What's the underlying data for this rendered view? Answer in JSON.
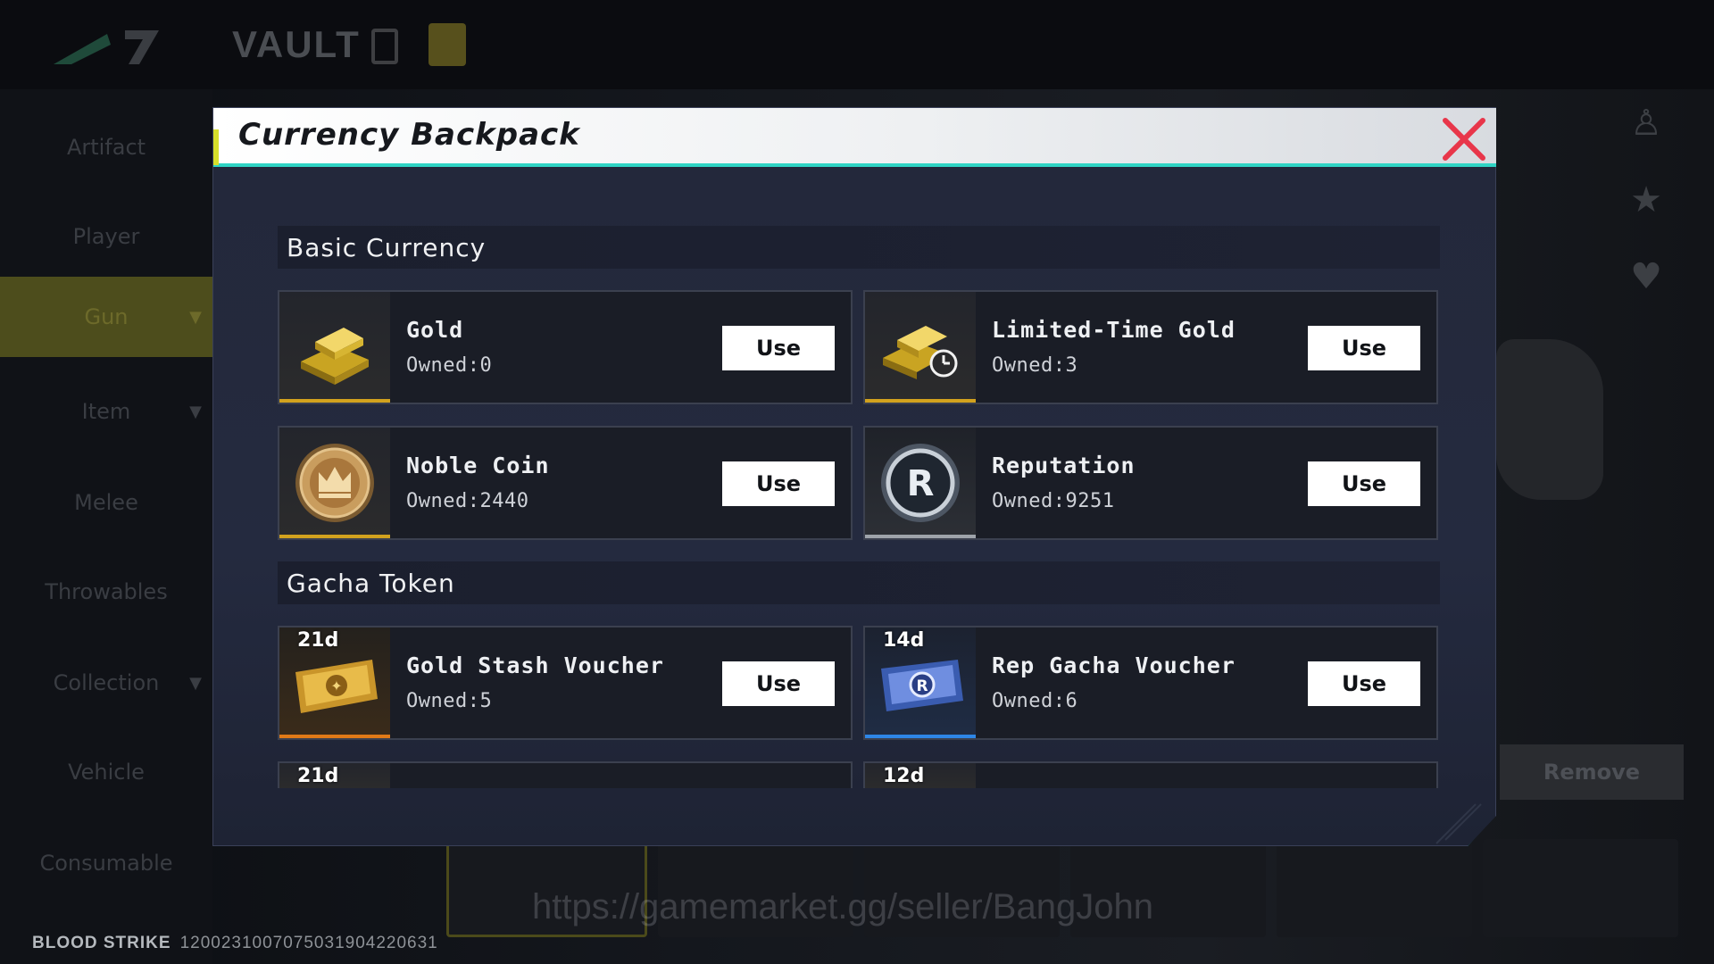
{
  "background": {
    "screen_title": "VAULT",
    "sidebar_items": [
      "Artifact",
      "Player",
      "Gun",
      "Item",
      "Melee",
      "Throwables",
      "Collection",
      "Vehicle",
      "Consumable"
    ],
    "remove_label": "Remove",
    "game_name": "BLOOD STRIKE",
    "player_id": "1200231007075031904220631",
    "watermark": "https://gamemarket.gg/seller/BangJohn"
  },
  "modal": {
    "title": "Currency Backpack",
    "close_icon": "close-icon",
    "sections": {
      "basic": {
        "title": "Basic Currency",
        "items": [
          {
            "name": "Gold",
            "owned": "Owned:0",
            "use": "Use",
            "icon": "gold-bars-icon",
            "accent": "#d2a21e"
          },
          {
            "name": "Limited-Time Gold",
            "owned": "Owned:3",
            "use": "Use",
            "icon": "limited-gold-icon",
            "accent": "#d2a21e"
          },
          {
            "name": "Noble Coin",
            "owned": "Owned:2440",
            "use": "Use",
            "icon": "noble-coin-icon",
            "accent": "#d2a21e"
          },
          {
            "name": "Reputation",
            "owned": "Owned:9251",
            "use": "Use",
            "icon": "reputation-icon",
            "accent": "#9ea3aa"
          }
        ]
      },
      "gacha": {
        "title": "Gacha Token",
        "items": [
          {
            "timer": "21d",
            "name": "Gold Stash Voucher",
            "owned": "Owned:5",
            "use": "Use",
            "icon": "gold-voucher-icon",
            "accent": "#e07a17"
          },
          {
            "timer": "14d",
            "name": "Rep Gacha Voucher",
            "owned": "Owned:6",
            "use": "Use",
            "icon": "rep-voucher-icon",
            "accent": "#2e86e6"
          },
          {
            "timer": "21d"
          },
          {
            "timer": "12d"
          }
        ]
      }
    }
  },
  "colors": {
    "header_accent": "#2fd4c4",
    "close_red": "#e8364a",
    "gold_accent": "#d2a21e"
  }
}
